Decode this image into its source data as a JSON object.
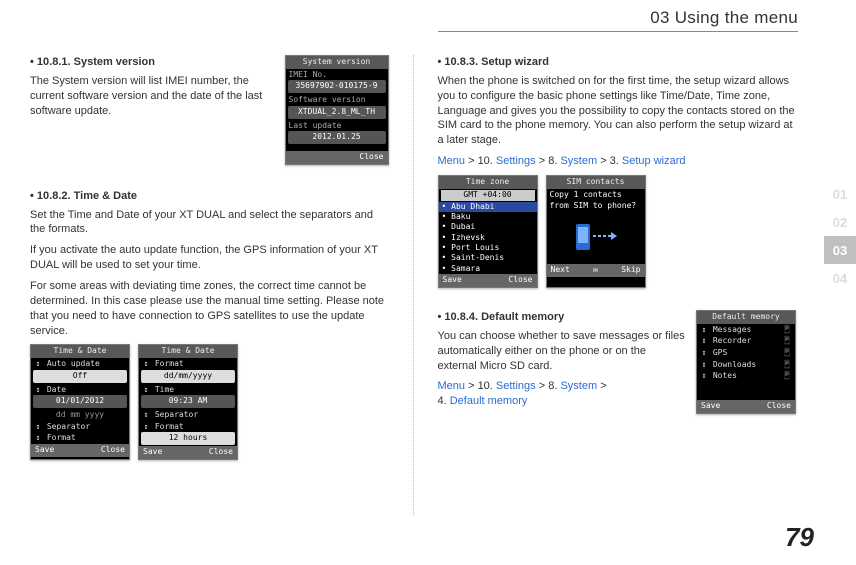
{
  "header": {
    "title": "03 Using the menu"
  },
  "tabs": {
    "t1": "01",
    "t2": "02",
    "t3": "03",
    "t4": "04"
  },
  "page_number": "79",
  "left": {
    "s1": {
      "title": "10.8.1. System version",
      "body": "The System version will list IMEI number, the current software version and the date of the last software update."
    },
    "ss_sysver": {
      "title": "System version",
      "l1": "IMEI No.",
      "v1": "35697902-010175-9",
      "l2": "Software version",
      "v2": "XTDUAL_2.8_ML_TH",
      "l3": "Last update",
      "v3": "2012.01.25",
      "close": "Close"
    },
    "s2": {
      "title": "10.8.2. Time & Date",
      "p1": "Set the Time and Date of your XT DUAL and select the separators and the formats.",
      "p2": "If you activate the auto update function, the GPS information of your XT DUAL will be used to set your time.",
      "p3": "For some areas with deviating time zones, the correct time cannot be determined. In this case please use the manual time setting. Please note that you need to have connection to GPS satellites to use the update service."
    },
    "ss_td_a": {
      "title": "Time & Date",
      "r1": "Auto update",
      "v1": "Off",
      "r2": "Date",
      "v2": "01/01/2012",
      "v2b": "dd mm yyyy",
      "r3": "Separator",
      "r4": "Format",
      "save": "Save",
      "close": "Close"
    },
    "ss_td_b": {
      "title": "Time & Date",
      "r1": "Format",
      "v1": "dd/mm/yyyy",
      "r2": "Time",
      "v2": "09:23 AM",
      "r3": "Separator",
      "r4": "Format",
      "v4": "12 hours",
      "save": "Save",
      "close": "Close"
    }
  },
  "right": {
    "s3": {
      "title": "10.8.3. Setup wizard",
      "body": "When the phone is switched on for the first time, the setup wizard allows you to configure the basic phone settings like Time/Date, Time zone, Language and gives you the possibility to copy the contacts stored on the SIM card to the phone memory. You can also perform the setup wizard at a later stage.",
      "nav": {
        "m": "Menu",
        "a": " > 10. ",
        "s": "Settings",
        "b": " > 8. ",
        "sys": "System",
        "c": " > 3. ",
        "sw": "Setup wizard"
      }
    },
    "ss_tz": {
      "title": "Time zone",
      "gmt": "GMT +04:00",
      "i1": "Abu Dhabi",
      "i2": "Baku",
      "i3": "Dubai",
      "i4": "Izhevsk",
      "i5": "Port Louis",
      "i6": "Saint-Denis",
      "i7": "Samara",
      "save": "Save",
      "close": "Close"
    },
    "ss_sim": {
      "title": "SIM contacts",
      "line1": "Copy 1 contacts",
      "line2": "from SIM to phone?",
      "next": "Next",
      "skip": "Skip"
    },
    "s4": {
      "title": "10.8.4. Default memory",
      "body": "You can choose whether to save messages or files automatically either on the phone or on the external Micro SD card.",
      "nav": {
        "m": "Menu",
        "a": " > 10. ",
        "s": "Settings",
        "b": " > 8. ",
        "sys": "System",
        "c": " > ",
        "n4": "4. ",
        "dm": "Default memory"
      }
    },
    "ss_dm": {
      "title": "Default memory",
      "r1": "Messages",
      "r2": "Recorder",
      "r3": "GPS",
      "r4": "Downloads",
      "r5": "Notes",
      "save": "Save",
      "close": "Close"
    }
  }
}
